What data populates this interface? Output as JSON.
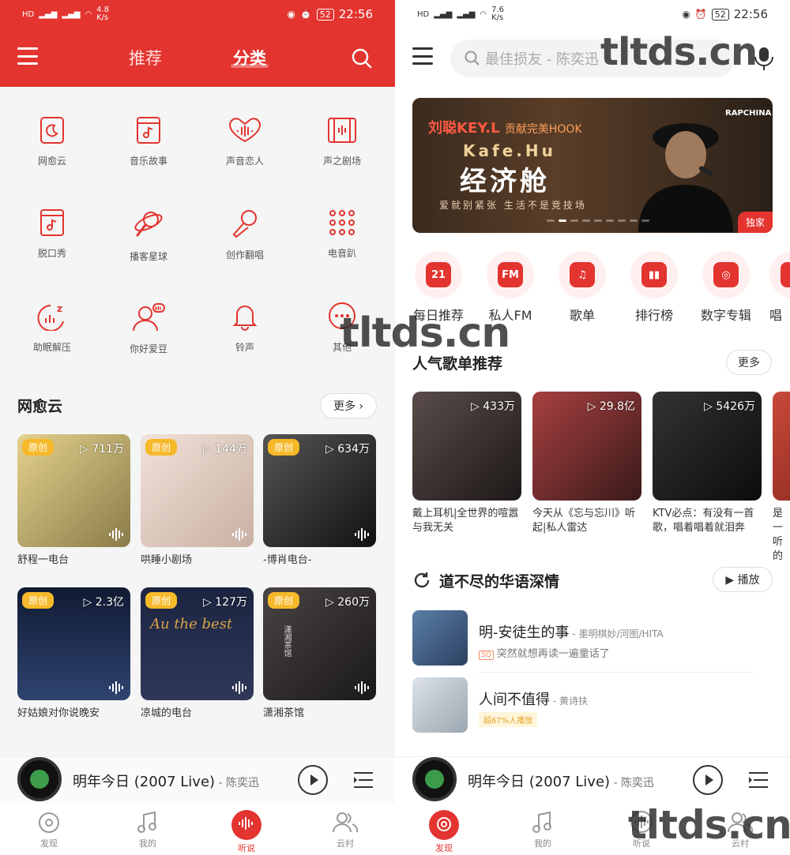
{
  "left": {
    "status": {
      "time": "22:56",
      "battery": "52",
      "net_speed": "4.8\nK/s"
    },
    "header": {
      "tab_recommend": "推荐",
      "tab_category": "分类"
    },
    "categories": [
      {
        "label": "网愈云",
        "icon": "cloud-moon-icon"
      },
      {
        "label": "音乐故事",
        "icon": "music-book-icon"
      },
      {
        "label": "声音恋人",
        "icon": "heart-wave-icon"
      },
      {
        "label": "声之剧场",
        "icon": "film-icon"
      },
      {
        "label": "脱口秀",
        "icon": "talk-book-icon"
      },
      {
        "label": "播客星球",
        "icon": "planet-mic-icon"
      },
      {
        "label": "创作翻唱",
        "icon": "microphone-icon"
      },
      {
        "label": "电音趴",
        "icon": "dots-grid-icon"
      },
      {
        "label": "助眠解压",
        "icon": "sleep-icon"
      },
      {
        "label": "你好爱豆",
        "icon": "hi-idol-icon"
      },
      {
        "label": "铃声",
        "icon": "bell-icon"
      },
      {
        "label": "其他",
        "icon": "more-dots-icon"
      }
    ],
    "section": {
      "title": "网愈云",
      "more": "更多 ›"
    },
    "cards": [
      {
        "tag": "原创",
        "plays": "▷ 711万",
        "title": "舒程一电台",
        "color": "#c9b977"
      },
      {
        "tag": "原创",
        "plays": "▷ 144万",
        "title": "哄睡小剧场",
        "color": "#e7d6cc"
      },
      {
        "tag": "原创",
        "plays": "▷ 634万",
        "title": "-博肖电台-",
        "color": "#2a2a2a"
      },
      {
        "tag": "原创",
        "plays": "▷ 2.3亿",
        "title": "好姑娘对你说晚安",
        "color": "#1d2a4a"
      },
      {
        "tag": "原创",
        "plays": "▷ 127万",
        "title": "凉城的电台",
        "color": "#1c2540"
      },
      {
        "tag": "原创",
        "plays": "▷ 260万",
        "title": "潇湘茶馆",
        "color": "#2d2a2a"
      }
    ],
    "card_overlay": {
      "script_text": "Au the best",
      "stamp_text": "潇湘茶馆"
    }
  },
  "right": {
    "status": {
      "time": "22:56",
      "battery": "52",
      "net_speed": "7.6\nK/s"
    },
    "search": {
      "placeholder": "最佳损友 - 陈奕迅"
    },
    "banner": {
      "line1": "刘聪KEY.L",
      "line1b": "贡献完美HOOK",
      "line2": "Kafe.Hu",
      "line3": "经济舱",
      "line4": "爱就别紧张 生活不是竞技场",
      "logo": "RAPCHINA",
      "badge": "独家"
    },
    "quick": [
      {
        "label": "每日推荐",
        "inner": "21"
      },
      {
        "label": "私人FM",
        "inner": "FM"
      },
      {
        "label": "歌单",
        "inner": "♫"
      },
      {
        "label": "排行榜",
        "inner": "▮▮"
      },
      {
        "label": "数字专辑",
        "inner": "◎"
      },
      {
        "label": "唱",
        "inner": "♪"
      }
    ],
    "playlists_section": {
      "title": "人气歌单推荐",
      "more": "更多"
    },
    "playlists": [
      {
        "plays": "▷ 433万",
        "title": "戴上耳机|全世界的喧嚣与我无关",
        "color": "#3a3434"
      },
      {
        "plays": "▷ 29.8亿",
        "title": "今天从《忘与忘川》听起|私人雷达",
        "color": "#7a2a2a"
      },
      {
        "plays": "▷ 5426万",
        "title": "KTV必点：有没有一首歌，唱着唱着就泪奔",
        "color": "#1e1e1e"
      },
      {
        "plays": "",
        "title": "是一听的",
        "color": "#b93a2a"
      }
    ],
    "songs_section": {
      "title": "道不尽的华语深情",
      "play": "▶ 播放"
    },
    "songs": [
      {
        "title": "明-安徒生的事",
        "artist": " - 墨明棋妙/河图/HITA",
        "badge": "SQ",
        "sub": "突然就想再读一遍童话了",
        "color": "#3e5d86"
      },
      {
        "title": "人间不值得",
        "artist": " - 黄诗扶",
        "badge": "",
        "sub": "超67%人播放",
        "color": "#c7cfd6"
      }
    ]
  },
  "player": {
    "title": "明年今日 (2007 Live)",
    "artist": " - 陈奕迅"
  },
  "tabbar": {
    "discover": "发现",
    "mine": "我的",
    "listen": "听说",
    "village": "云村"
  },
  "watermarks": {
    "text": "tltds.cn"
  },
  "colors": {
    "brand_red": "#e3342f",
    "tag_yellow": "#f6b929"
  }
}
